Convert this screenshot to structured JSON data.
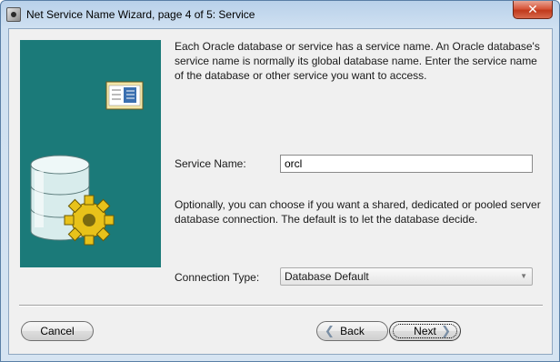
{
  "window": {
    "title": "Net Service Name Wizard, page 4 of 5: Service"
  },
  "icons": {
    "app": "app-icon",
    "close": "close-icon",
    "banner": "database-gear-illustration"
  },
  "colors": {
    "banner_bg": "#1b7a79",
    "titlebar": "#b9d1ea",
    "close": "#c0391b"
  },
  "main": {
    "intro": "Each Oracle database or service has a service name. An Oracle database's service name is normally its global database name. Enter the service name of the database or other service you want to access.",
    "service_name_label": "Service Name:",
    "service_name_value": "orcl",
    "connection_info": "Optionally, you can choose if you want a shared, dedicated or pooled server database connection. The default is to let the database decide.",
    "connection_type_label": "Connection Type:",
    "connection_type_value": "Database Default"
  },
  "buttons": {
    "cancel": "Cancel",
    "back": "Back",
    "next": "Next"
  }
}
